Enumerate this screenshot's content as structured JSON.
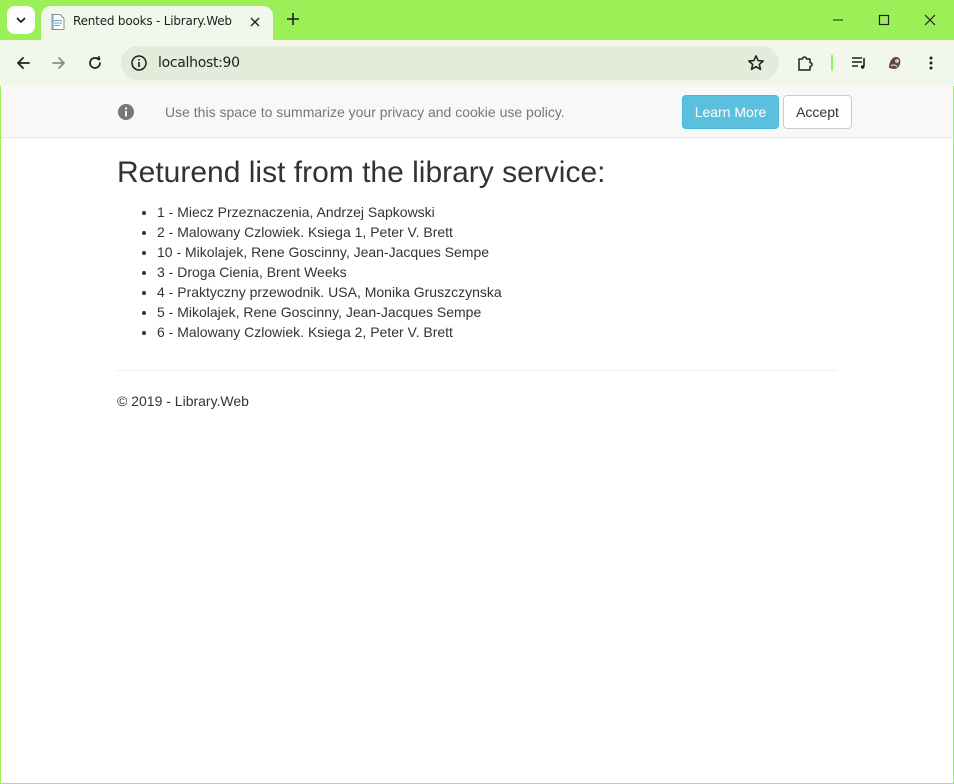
{
  "browser": {
    "tab_title": "Rented books - Library.Web",
    "url": "localhost:90",
    "icons": {
      "tab_search": "chevron-down-icon",
      "favicon": "document-icon",
      "tab_close": "close-icon",
      "new_tab": "plus-icon",
      "minimize": "minimize-icon",
      "maximize": "maximize-icon",
      "close_window": "close-icon",
      "back": "arrow-left-icon",
      "forward": "arrow-right-icon",
      "reload": "reload-icon",
      "site_info": "info-icon",
      "bookmark": "star-icon",
      "extensions": "puzzle-icon",
      "media": "playlist-icon",
      "profile": "avatar-icon",
      "menu": "kebab-menu-icon"
    },
    "colors": {
      "frame": "#9cf057",
      "toolbar": "#f2f7ec",
      "omnibox": "#e3ebdb"
    }
  },
  "cookie_consent": {
    "message": "Use this space to summarize your privacy and cookie use policy.",
    "learn_more_label": "Learn More",
    "accept_label": "Accept",
    "icon": "info-icon",
    "colors": {
      "learn_more_bg": "#5bc0de"
    }
  },
  "main": {
    "heading": "Returend list from the library service:",
    "books": [
      "1 - Miecz Przeznaczenia, Andrzej Sapkowski",
      "2 - Malowany Czlowiek. Ksiega 1, Peter V. Brett",
      "10 - Mikolajek, Rene Goscinny, Jean-Jacques Sempe",
      "3 - Droga Cienia, Brent Weeks",
      "4 - Praktyczny przewodnik. USA, Monika Gruszczynska",
      "5 - Mikolajek, Rene Goscinny, Jean-Jacques Sempe",
      "6 - Malowany Czlowiek. Ksiega 2, Peter V. Brett"
    ]
  },
  "footer": {
    "copyright": "© 2019 - Library.Web"
  }
}
